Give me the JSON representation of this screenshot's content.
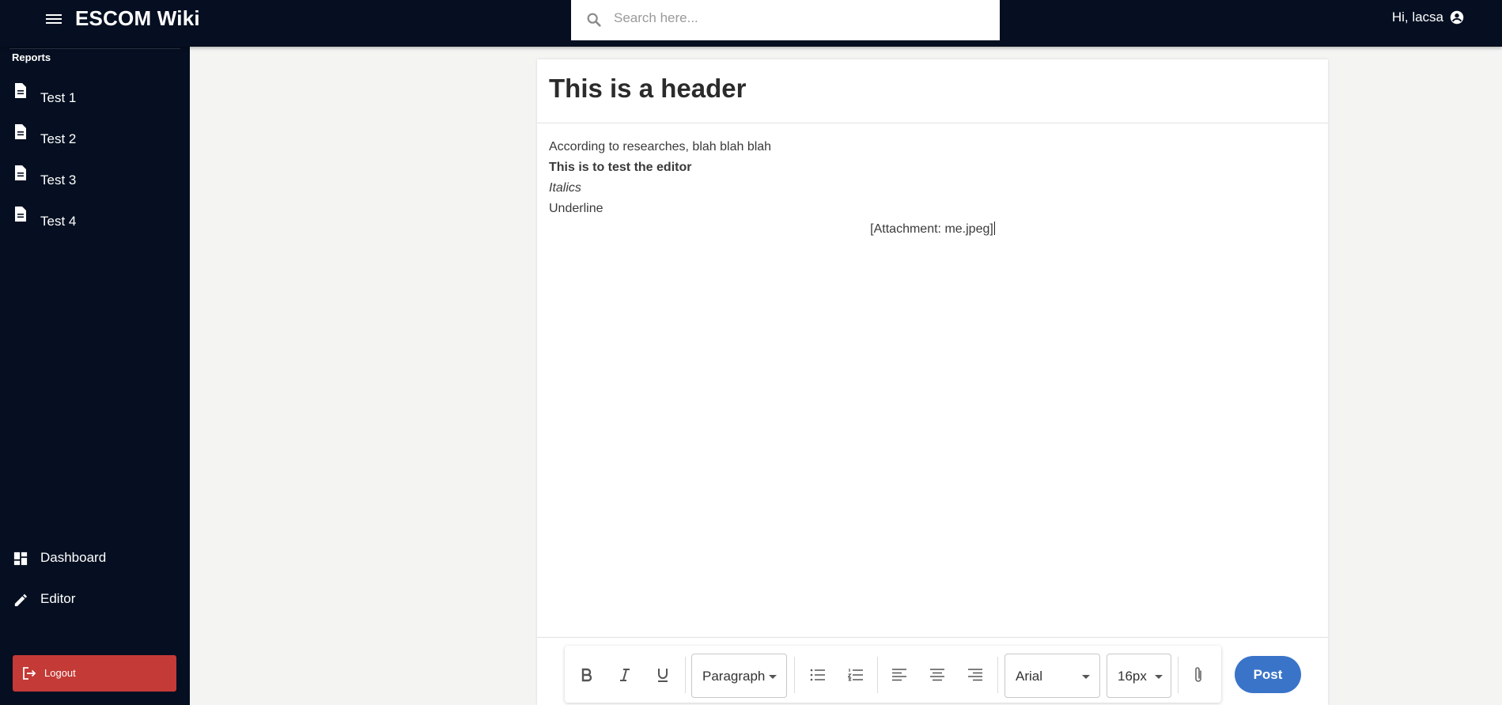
{
  "app": {
    "title": "ESCOM Wiki"
  },
  "search": {
    "placeholder": "Search here..."
  },
  "user": {
    "greeting": "Hi, lacsa"
  },
  "sidebar": {
    "section_label": "Reports",
    "reports": [
      {
        "label": "Test 1",
        "icon": "document-icon"
      },
      {
        "label": "Test 2",
        "icon": "document-icon"
      },
      {
        "label": "Test 3",
        "icon": "document-icon"
      },
      {
        "label": "Test 4",
        "icon": "document-icon"
      }
    ],
    "nav": [
      {
        "label": "Dashboard",
        "icon": "dashboard-icon"
      },
      {
        "label": "Editor",
        "icon": "pencil-icon"
      }
    ],
    "logout_label": "Logout"
  },
  "editor": {
    "title": "This is a header",
    "lines": {
      "normal": "According to researches, blah blah blah",
      "bold": "This is to test the editor",
      "italic": "Italics",
      "underline": "Underline",
      "attachment": "[Attachment: me.jpeg]"
    }
  },
  "toolbar": {
    "block_format": "Paragraph",
    "font_family": "Arial",
    "font_size": "16px",
    "post_label": "Post"
  },
  "colors": {
    "nav_bg": "#050f21",
    "logout_bg": "#c43a36",
    "post_bg": "#3a74c9",
    "page_bg": "#f4f4f3"
  }
}
